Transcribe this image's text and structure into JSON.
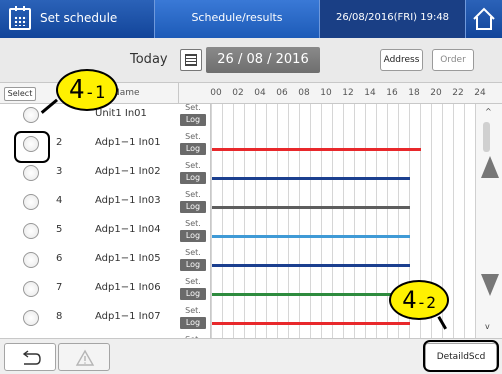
{
  "header": {
    "title": "Set schedule",
    "tab": "Schedule/results",
    "datetime": "26/08/2016(FRI) 19:48",
    "home_icon": "home-icon",
    "calendar_icon": "calendar-icon"
  },
  "toolbar": {
    "today_label": "Today",
    "date_value": "26 / 08 / 2016",
    "address_button": "Address",
    "order_button": "Order"
  },
  "table": {
    "select_label": "Select",
    "name_header": "Name",
    "hours": [
      "00",
      "02",
      "04",
      "06",
      "08",
      "10",
      "12",
      "14",
      "16",
      "18",
      "20",
      "22",
      "24"
    ],
    "set_label": "Set.",
    "log_label": "Log",
    "rows": [
      {
        "num": "",
        "name": "Unit1 In01",
        "bar_color": "",
        "bar_start_hour": 0,
        "bar_end_hour": 0
      },
      {
        "num": "2",
        "name": "Adp1−1 In01",
        "bar_color": "#e8282b",
        "bar_start_hour": 0,
        "bar_end_hour": 19
      },
      {
        "num": "3",
        "name": "Adp1−1 In02",
        "bar_color": "#1b3f8f",
        "bar_start_hour": 0,
        "bar_end_hour": 18
      },
      {
        "num": "4",
        "name": "Adp1−1 In03",
        "bar_color": "#5e5e5e",
        "bar_start_hour": 0,
        "bar_end_hour": 18
      },
      {
        "num": "5",
        "name": "Adp1−1 In04",
        "bar_color": "#3f9ad6",
        "bar_start_hour": 0,
        "bar_end_hour": 18
      },
      {
        "num": "6",
        "name": "Adp1−1 In05",
        "bar_color": "#1b3f8f",
        "bar_start_hour": 0,
        "bar_end_hour": 18
      },
      {
        "num": "7",
        "name": "Adp1−1 In06",
        "bar_color": "#2e8b3e",
        "bar_start_hour": 0,
        "bar_end_hour": 18
      },
      {
        "num": "8",
        "name": "Adp1−1 In07",
        "bar_color": "#e8282b",
        "bar_start_hour": 0,
        "bar_end_hour": 18
      },
      {
        "num": "",
        "name": "",
        "bar_color": "",
        "bar_start_hour": 0,
        "bar_end_hour": 0
      }
    ]
  },
  "scroll": {
    "up_small": "^",
    "down_small": "v"
  },
  "bottom": {
    "back_icon": "back-arrow-icon",
    "warning_icon": "warning-icon",
    "detail_button": "DetaildScd"
  },
  "callouts": {
    "c1_main": "4",
    "c1_sub": "-1",
    "c2_main": "4",
    "c2_sub": "-2"
  }
}
